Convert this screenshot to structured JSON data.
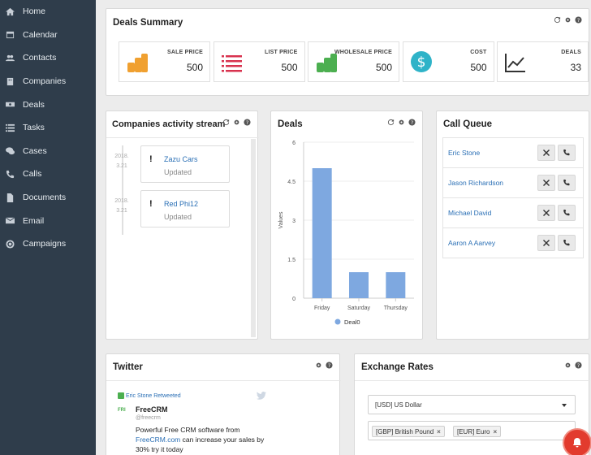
{
  "sidebar": {
    "items": [
      {
        "label": "Home",
        "icon": "home-icon"
      },
      {
        "label": "Calendar",
        "icon": "calendar-icon"
      },
      {
        "label": "Contacts",
        "icon": "contacts-icon"
      },
      {
        "label": "Companies",
        "icon": "building-icon"
      },
      {
        "label": "Deals",
        "icon": "money-icon"
      },
      {
        "label": "Tasks",
        "icon": "list-icon"
      },
      {
        "label": "Cases",
        "icon": "chat-icon"
      },
      {
        "label": "Calls",
        "icon": "phone-icon"
      },
      {
        "label": "Documents",
        "icon": "document-icon"
      },
      {
        "label": "Email",
        "icon": "envelope-icon"
      },
      {
        "label": "Campaigns",
        "icon": "target-icon"
      }
    ]
  },
  "deals_summary": {
    "title": "Deals Summary",
    "kpis": [
      {
        "label": "SALE PRICE",
        "value": "500",
        "icon": "coins-icon",
        "color": "#f0a030"
      },
      {
        "label": "LIST PRICE",
        "value": "500",
        "icon": "list-icon",
        "color": "#d8334f"
      },
      {
        "label": "WHOLESALE PRICE",
        "value": "500",
        "icon": "coins-icon",
        "color": "#4caf50"
      },
      {
        "label": "COST",
        "value": "500",
        "icon": "dollar-icon",
        "color": "#2fb3c8"
      },
      {
        "label": "DEALS",
        "value": "33",
        "icon": "trend-icon",
        "color": "#333333"
      }
    ]
  },
  "activity": {
    "title": "Companies activity stream",
    "items": [
      {
        "date_line1": "2018.",
        "date_line2": "3.21",
        "name": "Zazu Cars",
        "status": "Updated"
      },
      {
        "date_line1": "2018.",
        "date_line2": "3.21",
        "name": "Red Phi12",
        "status": "Updated"
      }
    ]
  },
  "deals_chart": {
    "title": "Deals"
  },
  "chart_data": {
    "type": "bar",
    "categories": [
      "Friday",
      "Saturday",
      "Thursday"
    ],
    "series": [
      {
        "name": "Deal0",
        "values": [
          5,
          1,
          1
        ],
        "color": "#7ea8e0"
      }
    ],
    "ylabel": "Values",
    "yticks": [
      "0",
      "1.5",
      "3",
      "4.5",
      "6"
    ],
    "ylim": [
      0,
      6
    ],
    "legend": "bottom"
  },
  "call_queue": {
    "title": "Call Queue",
    "items": [
      {
        "name": "Eric Stone"
      },
      {
        "name": "Jason Richardson"
      },
      {
        "name": "Michael David"
      },
      {
        "name": "Aaron A Aarvey"
      }
    ]
  },
  "twitter": {
    "title": "Twitter",
    "retweet": "Eric Stone Retweeted",
    "avatar_text": "FRI",
    "name": "FreeCRM",
    "handle": "@freecrm",
    "text_pre": "Powerful Free CRM software from",
    "link": "FreeCRM.com",
    "text_post": "can increase your sales by 30% try it today"
  },
  "exchange": {
    "title": "Exchange Rates",
    "base": "[USD] US Dollar",
    "tags": [
      "[GBP] British Pound",
      "[EUR] Euro"
    ]
  }
}
